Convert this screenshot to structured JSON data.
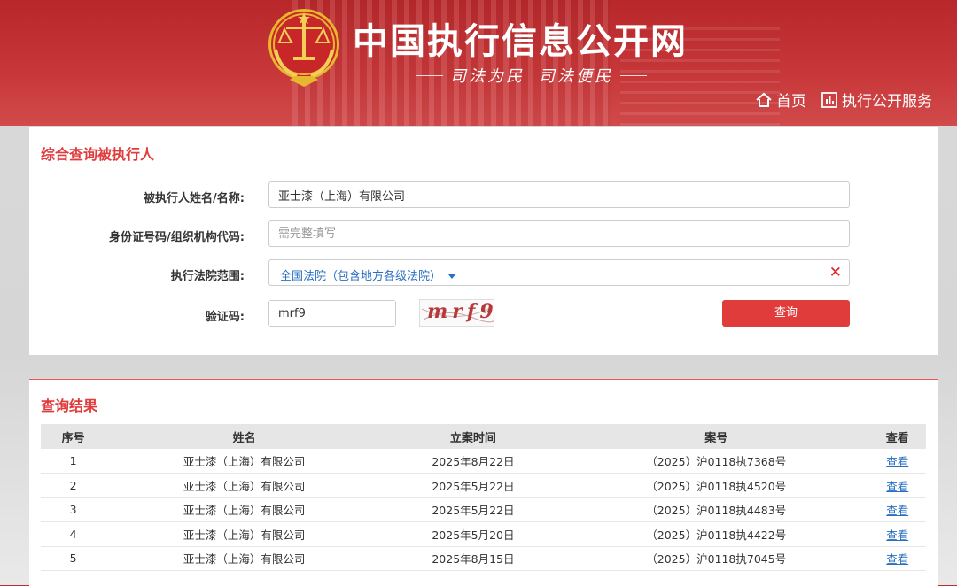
{
  "header": {
    "title": "中国执行信息公开网",
    "slogan_left": "司法为民",
    "slogan_right": "司法便民",
    "nav": [
      {
        "label": "首页",
        "icon": "home-icon"
      },
      {
        "label": "执行公开服务",
        "icon": "chart-bar-icon"
      }
    ]
  },
  "search": {
    "title": "综合查询被执行人",
    "name_label": "被执行人姓名/名称:",
    "name_value": "亚士漆（上海）有限公司",
    "id_label": "身份证号码/组织机构代码:",
    "id_placeholder": "需完整填写",
    "court_label": "执行法院范围:",
    "court_value": "全国法院（包含地方各级法院）",
    "captcha_label": "验证码:",
    "captcha_value": "mrf9",
    "captcha_image_text": "mrf9",
    "submit_label": "查询"
  },
  "results": {
    "title": "查询结果",
    "columns": [
      "序号",
      "姓名",
      "立案时间",
      "案号",
      "查看"
    ],
    "rows": [
      {
        "no": "1",
        "name": "亚士漆（上海）有限公司",
        "date": "2025年8月22日",
        "case": "（2025）沪0118执7368号",
        "view": "查看"
      },
      {
        "no": "2",
        "name": "亚士漆（上海）有限公司",
        "date": "2025年5月22日",
        "case": "（2025）沪0118执4520号",
        "view": "查看"
      },
      {
        "no": "3",
        "name": "亚士漆（上海）有限公司",
        "date": "2025年5月22日",
        "case": "（2025）沪0118执4483号",
        "view": "查看"
      },
      {
        "no": "4",
        "name": "亚士漆（上海）有限公司",
        "date": "2025年5月20日",
        "case": "（2025）沪0118执4422号",
        "view": "查看"
      },
      {
        "no": "5",
        "name": "亚士漆（上海）有限公司",
        "date": "2025年8月15日",
        "case": "（2025）沪0118执7045号",
        "view": "查看"
      }
    ]
  },
  "colors": {
    "brand_red": "#e03c3c",
    "link_blue": "#2a6fc2",
    "header_red": "#c23335"
  }
}
